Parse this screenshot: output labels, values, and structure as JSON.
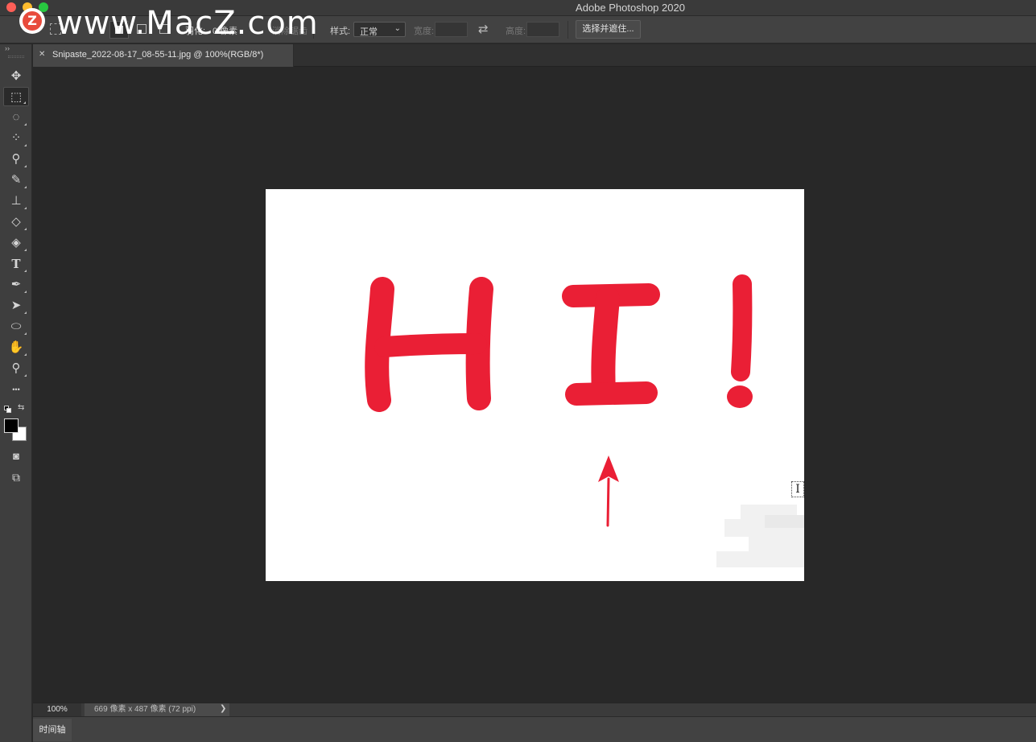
{
  "window": {
    "title": "Adobe Photoshop 2020"
  },
  "watermark": {
    "badge": "Z",
    "text": "www.MacZ.com"
  },
  "options_bar": {
    "feather_label": "羽化:",
    "feather_value": "0 像素",
    "antialias_label": "消除锯齿",
    "style_label": "样式:",
    "style_value": "正常",
    "width_label": "宽度:",
    "height_label": "高度:",
    "select_mask_button": "选择并遮住..."
  },
  "document": {
    "tab_name": "Snipaste_2022-08-17_08-55-11.jpg @ 100%(RGB/8*)",
    "close_glyph": "✕"
  },
  "toolbar": {
    "collapse": "››",
    "tools": [
      {
        "name": "move-tool",
        "icon": "move-icon",
        "glyph": "✥",
        "active": false
      },
      {
        "name": "marquee-tool",
        "icon": "rect-marquee-icon",
        "glyph": "⬚",
        "active": true
      },
      {
        "name": "lasso-tool",
        "icon": "lasso-icon",
        "glyph": "◌",
        "active": false
      },
      {
        "name": "quick-select-tool",
        "icon": "quick-select-icon",
        "glyph": "⁘",
        "active": false
      },
      {
        "name": "eyedropper-tool",
        "icon": "eyedropper-icon",
        "glyph": "⚲",
        "active": false
      },
      {
        "name": "brush-tool",
        "icon": "brush-icon",
        "glyph": "✎",
        "active": false
      },
      {
        "name": "stamp-tool",
        "icon": "stamp-icon",
        "glyph": "⊥",
        "active": false
      },
      {
        "name": "eraser-tool",
        "icon": "eraser-icon",
        "glyph": "◇",
        "active": false
      },
      {
        "name": "paint-bucket-tool",
        "icon": "paint-bucket-icon",
        "glyph": "◈",
        "active": false
      },
      {
        "name": "type-tool",
        "icon": "type-icon",
        "glyph": "T",
        "active": false
      },
      {
        "name": "pen-tool",
        "icon": "pen-icon",
        "glyph": "✒",
        "active": false
      },
      {
        "name": "path-select-tool",
        "icon": "arrow-pointer-icon",
        "glyph": "➤",
        "active": false
      },
      {
        "name": "ellipse-tool",
        "icon": "ellipse-icon",
        "glyph": "⬭",
        "active": false
      },
      {
        "name": "hand-tool",
        "icon": "hand-icon",
        "glyph": "✋",
        "active": false
      },
      {
        "name": "zoom-tool",
        "icon": "magnifier-icon",
        "glyph": "⚲",
        "active": false
      },
      {
        "name": "more-tools",
        "icon": "ellipsis-icon",
        "glyph": "•••",
        "active": false
      }
    ],
    "quick_mask_glyph": "◙",
    "screen_mode_glyph": "⧉",
    "swap_glyph": "⇆",
    "fg_color": "#000000",
    "bg_color": "#ffffff"
  },
  "status": {
    "zoom": "100%",
    "doc_info": "669 像素 x 487 像素 (72 ppi)",
    "arrow": "❯"
  },
  "timeline": {
    "tab_label": "时间轴"
  },
  "canvas": {
    "artwork_color": "#ea1f35",
    "cursor_glyph": "I"
  }
}
